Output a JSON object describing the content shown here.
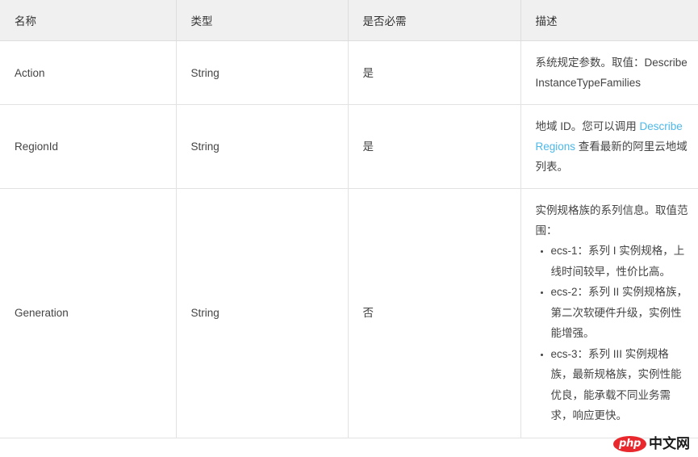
{
  "table": {
    "headers": [
      {
        "label": "名称"
      },
      {
        "label": "类型"
      },
      {
        "label": "是否必需"
      },
      {
        "label": "描述"
      }
    ],
    "rows": [
      {
        "name": "Action",
        "type": "String",
        "required": "是",
        "description": {
          "paragraph": "系统规定参数。取值：DescribeInstanceTypeFamilies",
          "items": []
        }
      },
      {
        "name": "RegionId",
        "type": "String",
        "required": "是",
        "description": {
          "paragraph_before_link": "地域 ID。您可以调用 ",
          "link_text": "DescribeRegions",
          "paragraph_after_link": " 查看最新的阿里云地域列表。",
          "items": []
        }
      },
      {
        "name": "Generation",
        "type": "String",
        "required": "否",
        "description": {
          "paragraph": "实例规格族的系列信息。取值范围：",
          "items": [
            "ecs-1：系列 I 实例规格，上线时间较早，性价比高。",
            "ecs-2：系列 II 实例规格族，第二次软硬件升级，实例性能增强。",
            "ecs-3：系列 III 实例规格族，最新规格族，实例性能优良，能承载不同业务需求，响应更快。"
          ]
        }
      }
    ]
  },
  "watermark": {
    "badge_text": "php",
    "site_text": "中文网"
  },
  "colors": {
    "link": "#4db8e8",
    "header_bg": "#f0f0f0",
    "border": "#e2e2e2",
    "watermark_red": "#e8282c"
  }
}
